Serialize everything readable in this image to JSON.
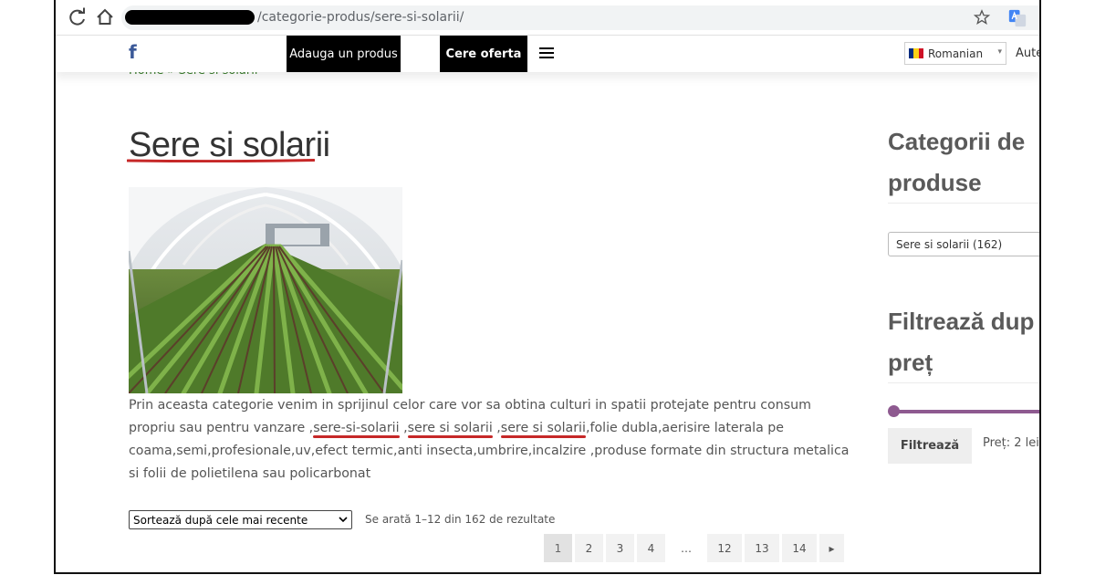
{
  "browser": {
    "url_path": "/categorie-produs/sere-si-solarii/",
    "icons": [
      "reload-icon",
      "home-icon",
      "star-icon",
      "translate-icon"
    ]
  },
  "header": {
    "facebook_label": "f",
    "add_product_label": "Adauga un produs",
    "offer_label": "Cere oferta",
    "language": "Romanian",
    "auth_link": "Aute",
    "flag_colors": [
      "#002B7F",
      "#FCD116",
      "#CE1126"
    ]
  },
  "breadcrumb": "Home » Sere si solarii",
  "page": {
    "title": "Sere si solarii",
    "description": {
      "part1": "Prin aceasta categorie venim in sprijinul celor care vor sa obtina culturi in spatii protejate pentru consum propriu sau pentru vanzare ,",
      "kw1": "sere-si-solarii",
      "sep1": " ,",
      "kw2": "sere si solarii",
      "sep2": " ,",
      "kw3": "sere si solarii",
      "part2": ",folie dubla,aerisire laterala pe coama,semi,profesionale,uv,efect termic,anti insecta,umbrire,incalzire ,produse formate din structura metalica si folii de polietilena sau policarbonat"
    },
    "sort_selected": "Sortează după cele mai recente",
    "result_count": "Se arată 1–12 din 162 de rezultate",
    "pagination": [
      "1",
      "2",
      "3",
      "4",
      "…",
      "12",
      "13",
      "14",
      "▸"
    ],
    "current_page": "1"
  },
  "sidebar": {
    "categories_heading_line1": "Categorii de",
    "categories_heading_line2": "produse",
    "category_selected": "Sere si solarii  (162)",
    "filter_heading_line1": "Filtrează dup",
    "filter_heading_line2": "preț",
    "filter_button": "Filtrează",
    "price_range": "Preț: 2 lei –",
    "slider_color": "#8e5a90"
  },
  "colors": {
    "keyword_underline": "#c62828",
    "breadcrumb": "#3a7d2c",
    "header_button": "#000000"
  }
}
